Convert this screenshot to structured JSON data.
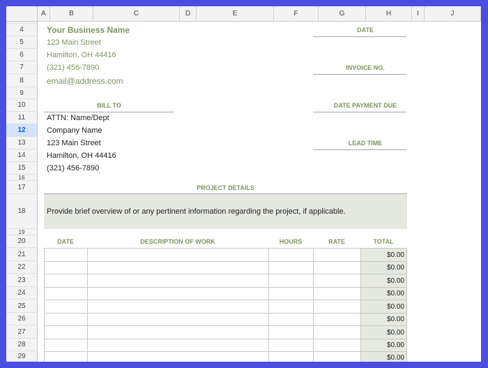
{
  "columns": [
    "A",
    "B",
    "C",
    "D",
    "E",
    "F",
    "G",
    "H",
    "I",
    "J"
  ],
  "rows": [
    "4",
    "5",
    "6",
    "7",
    "8",
    "9",
    "10",
    "11",
    "12",
    "13",
    "14",
    "15",
    "16",
    "17",
    "18",
    "19",
    "20",
    "21",
    "22",
    "23",
    "24",
    "25",
    "26",
    "27",
    "28",
    "29"
  ],
  "selected_row": "12",
  "business": {
    "name": "Your Business Name",
    "street": "123 Main Street",
    "city": "Hamilton, OH 44416",
    "phone": "(321) 456-7890",
    "email": "email@address.com"
  },
  "labels": {
    "date": "DATE",
    "invoice_no": "INVOICE NO.",
    "bill_to": "BILL TO",
    "date_payment_due": "DATE PAYMENT DUE",
    "lead_time": "LEAD TIME",
    "project_details": "PROJECT DETAILS"
  },
  "bill_to": {
    "attn": "ATTN: Name/Dept",
    "company": "Company Name",
    "street": "123 Main Street",
    "city": "Hamilton, OH 44416",
    "phone": "(321) 456-7890"
  },
  "project_overview": "Provide brief overview of or any pertinent information regarding the project, if applicable.",
  "table": {
    "headers": [
      "DATE",
      "DESCRIPTION OF WORK",
      "HOURS",
      "RATE",
      "TOTAL"
    ],
    "totals": [
      "$0.00",
      "$0.00",
      "$0.00",
      "$0.00",
      "$0.00",
      "$0.00",
      "$0.00",
      "$0.00",
      "$0.00"
    ]
  }
}
